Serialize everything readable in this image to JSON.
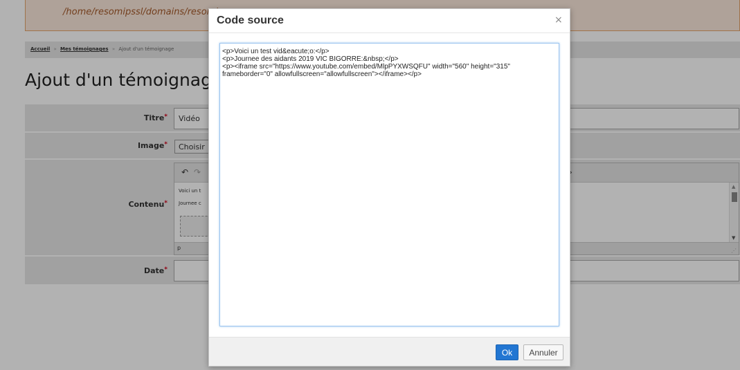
{
  "page": {
    "error_path": "/home/resomipssl/domains/resomip.c",
    "breadcrumb": {
      "home": "Accueil",
      "section": "Mes témoignages",
      "current": "Ajout d'un témoignage",
      "separator": "»"
    },
    "title": "Ajout d'un témoignage",
    "form": {
      "required_marker": "*",
      "titre_label": "Titre",
      "titre_value": "Vidéo",
      "image_label": "Image",
      "image_button": "Choisir",
      "contenu_label": "Contenu",
      "contenu_line1": "Voici un t",
      "contenu_line2": "Journee c",
      "editor_path": "p",
      "date_label": "Date"
    }
  },
  "modal": {
    "title": "Code source",
    "close_symbol": "×",
    "source": "<p>Voici un test vid&eacute;o:</p>\n<p>Journee des aidants 2019 VIC BIGORRE:&nbsp;</p>\n<p><iframe src=\"https://www.youtube.com/embed/MlpPYXWSQFU\" width=\"560\" height=\"315\" frameborder=\"0\" allowfullscreen=\"allowfullscreen\"></iframe></p>",
    "ok_label": "Ok",
    "cancel_label": "Annuler"
  },
  "colors": {
    "accent": "#2276d2",
    "required": "#d0021b",
    "overlay": "rgba(0,0,0,0.3)"
  }
}
